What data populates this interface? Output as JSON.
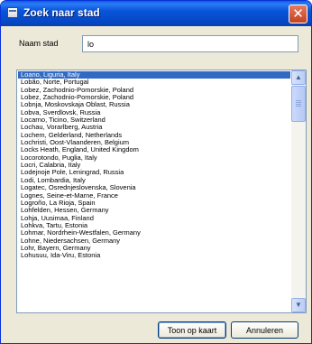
{
  "window": {
    "title": "Zoek naar stad",
    "close_glyph": "✕"
  },
  "search": {
    "label": "Naam stad",
    "value": "lo"
  },
  "results": {
    "selected_index": 0,
    "items": [
      "Loano, Liguria, Italy",
      "Lobão, Norte, Portugal",
      "Lobez, Zachodnio-Pomorskie, Poland",
      "Lobez, Zachodnio-Pomorskie, Poland",
      "Lobnja, Moskovskaja Oblast, Russia",
      "Lobva, Sverdlovsk, Russia",
      "Locarno, Ticino, Switzerland",
      "Lochau, Vorarlberg, Austria",
      "Lochem, Gelderland, Netherlands",
      "Lochristi, Oost-Vlaanderen, Belgium",
      "Locks Heath, England, United Kingdom",
      "Locorotondo, Puglia, Italy",
      "Locri, Calabria, Italy",
      "Lodejnoje Pole, Leningrad, Russia",
      "Lodi, Lombardia, Italy",
      "Logatec, Osrednjeslovenska, Slovenia",
      "Lognes, Seine-et-Marne, France",
      "Logroño, La Rioja, Spain",
      "Lohfelden, Hessen, Germany",
      "Lohja, Uusimaa, Finland",
      "Lohkva, Tartu, Estonia",
      "Lohmar, Nordrhein-Westfalen, Germany",
      "Lohne, Niedersachsen, Germany",
      "Lohr, Bayern, Germany",
      "Lohusuu, Ida-Viru, Estonia"
    ]
  },
  "scrollbar": {
    "up_glyph": "▲",
    "down_glyph": "▼"
  },
  "buttons": {
    "ok": "Toon op kaart",
    "cancel": "Annuleren"
  },
  "colors": {
    "titlebar": "#0854d8",
    "selection": "#316ac5",
    "dialog": "#ece9d8"
  }
}
